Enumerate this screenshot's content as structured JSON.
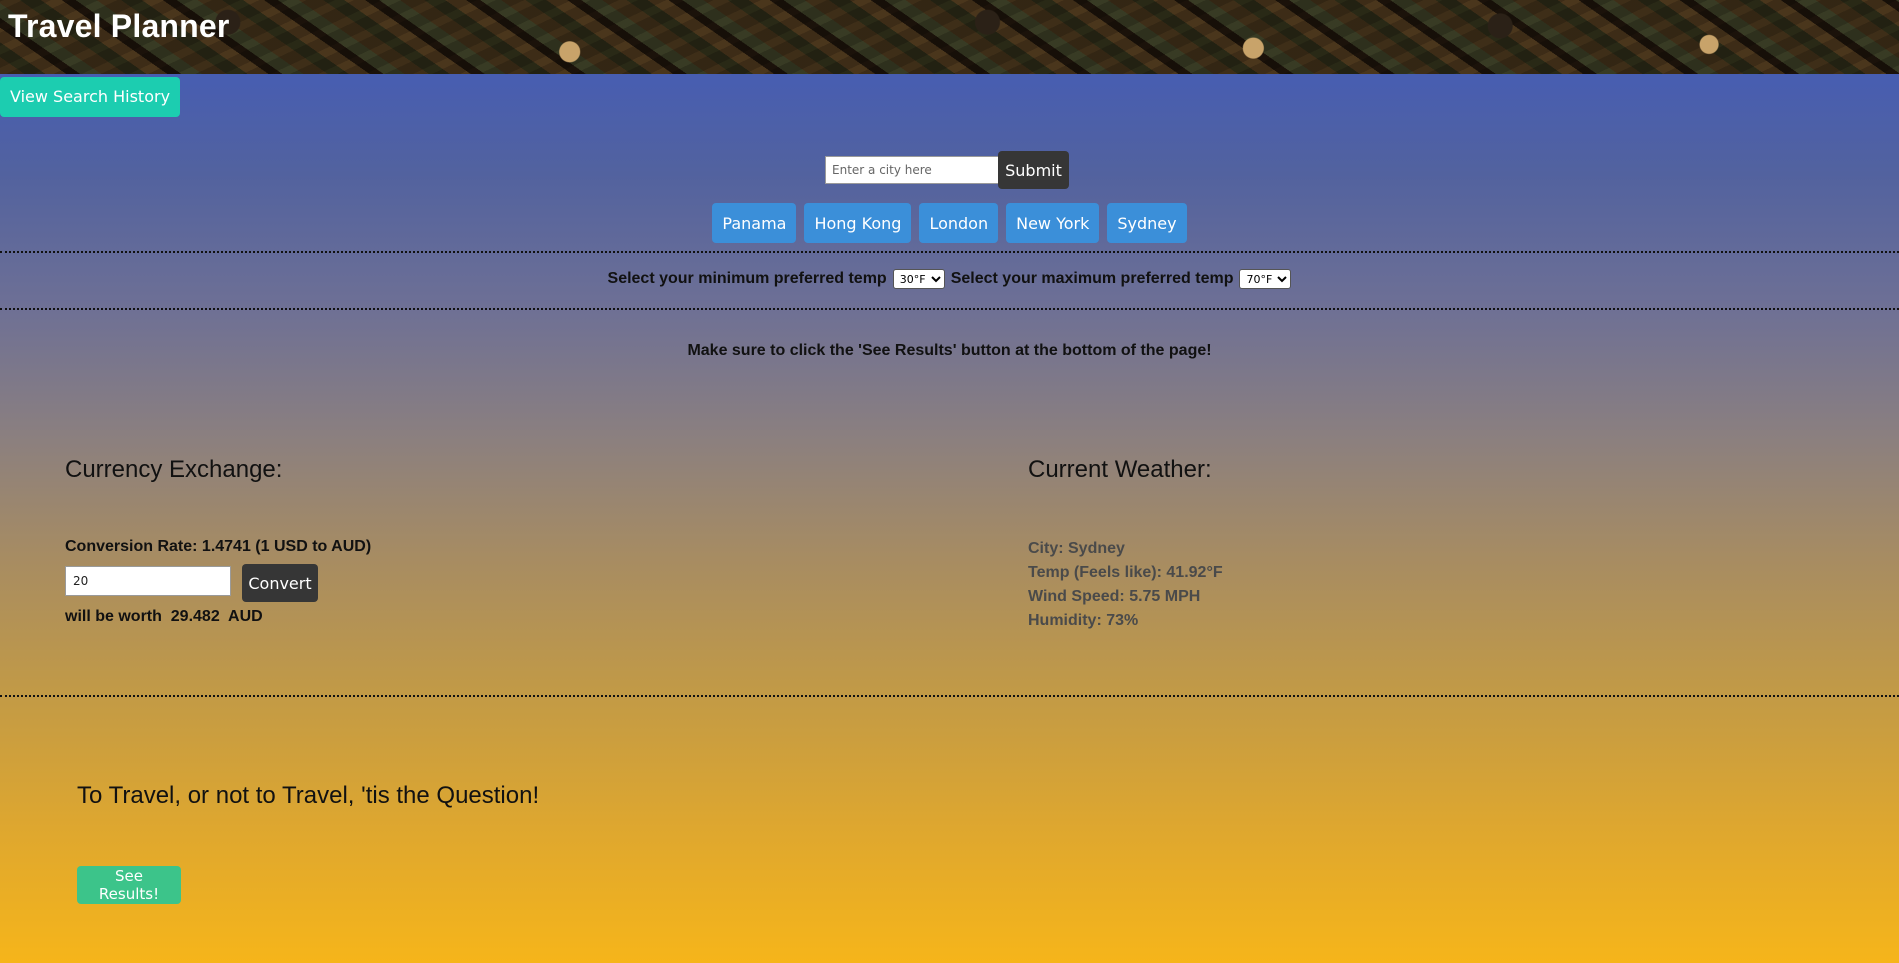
{
  "header": {
    "title": "Travel Planner"
  },
  "history": {
    "button_label": "View Search History"
  },
  "search": {
    "placeholder": "Enter a city here",
    "value": "",
    "submit_label": "Submit"
  },
  "cities": [
    {
      "label": "Panama"
    },
    {
      "label": "Hong Kong"
    },
    {
      "label": "London"
    },
    {
      "label": "New York"
    },
    {
      "label": "Sydney"
    }
  ],
  "temps": {
    "min_label": "Select your minimum preferred temp",
    "min_value": "30°F",
    "max_label": "Select your maximum preferred temp",
    "max_value": "70°F"
  },
  "notice": "Make sure to click the 'See Results' button at the bottom of the page!",
  "currency": {
    "title": "Currency Exchange:",
    "rate_text": "Conversion Rate: 1.4741 (1 USD to AUD)",
    "amount": "20",
    "convert_label": "Convert",
    "result_prefix": "will be worth",
    "result_value": "29.482",
    "result_currency": "AUD"
  },
  "weather": {
    "title": "Current Weather:",
    "city": "City: Sydney",
    "temp": "Temp (Feels like): 41.92°F",
    "wind": "Wind Speed: 5.75 MPH",
    "humidity": "Humidity: 73%"
  },
  "results": {
    "question": "To Travel, or not to Travel, 'tis the Question!",
    "button_label": "See Results!"
  },
  "colors": {
    "history_button": "#1ccdb0",
    "dark_button": "#363636",
    "city_button": "#3b8fd9",
    "results_button": "#3cc48a",
    "gradient_top": "#3f5abf",
    "gradient_bottom": "#f6b51a"
  }
}
